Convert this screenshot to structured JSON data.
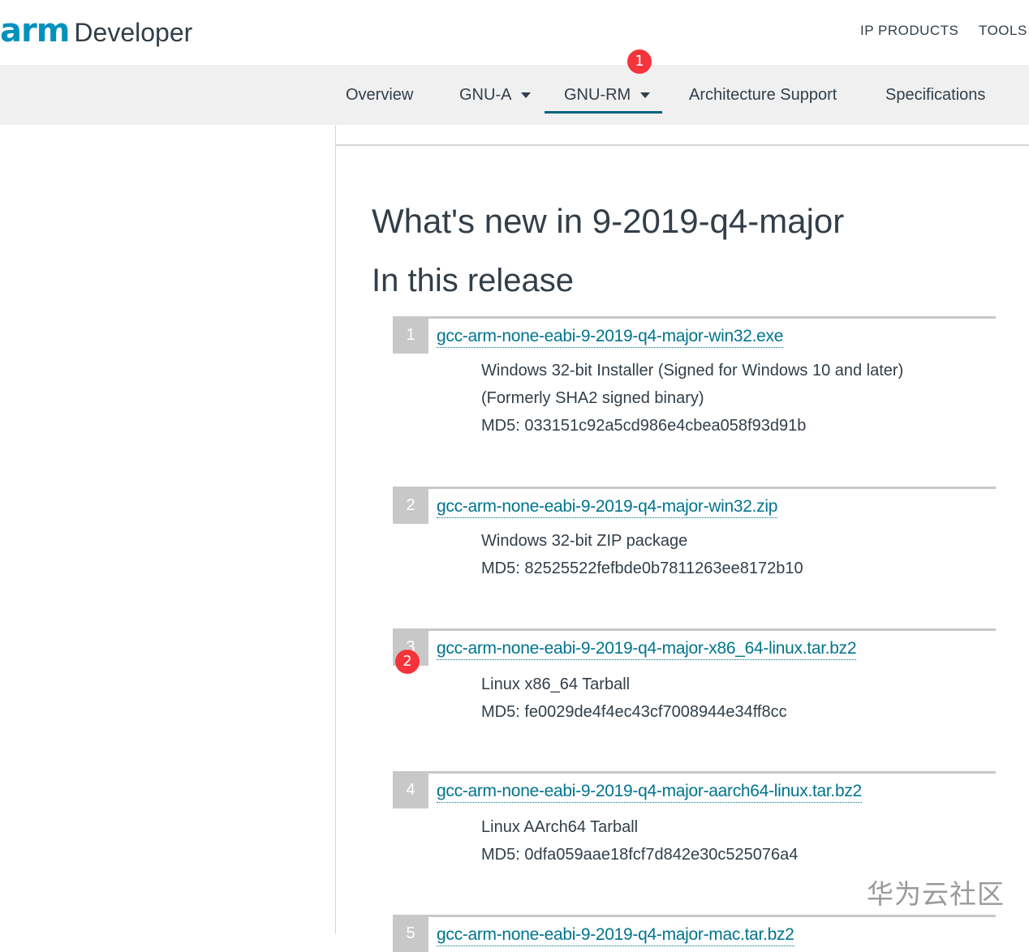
{
  "header": {
    "logo_arm": "arm",
    "logo_developer": "Developer",
    "links": [
      {
        "label": "IP PRODUCTS"
      },
      {
        "label": "TOOLS A"
      }
    ]
  },
  "subnav": {
    "items": [
      {
        "label": "Overview",
        "has_dropdown": false,
        "active": false
      },
      {
        "label": "GNU-A",
        "has_dropdown": true,
        "active": false
      },
      {
        "label": "GNU-RM",
        "has_dropdown": true,
        "active": true
      },
      {
        "label": "Architecture Support",
        "has_dropdown": false,
        "active": false
      },
      {
        "label": "Specifications",
        "has_dropdown": false,
        "active": false
      }
    ]
  },
  "annotations": [
    {
      "label": "1"
    },
    {
      "label": "2"
    }
  ],
  "main": {
    "title": "What's new in 9-2019-q4-major",
    "section_title": "In this release",
    "releases": [
      {
        "number": "1",
        "file": "gcc-arm-none-eabi-9-2019-q4-major-win32.exe",
        "description_lines": [
          "Windows 32-bit Installer (Signed for Windows 10 and later)",
          "(Formerly SHA2 signed binary)",
          "MD5: 033151c92a5cd986e4cbea058f93d91b"
        ]
      },
      {
        "number": "2",
        "file": "gcc-arm-none-eabi-9-2019-q4-major-win32.zip",
        "description_lines": [
          "Windows 32-bit ZIP package",
          "MD5: 82525522fefbde0b7811263ee8172b10"
        ]
      },
      {
        "number": "3",
        "file": "gcc-arm-none-eabi-9-2019-q4-major-x86_64-linux.tar.bz2",
        "description_lines": [
          "Linux x86_64 Tarball",
          "MD5: fe0029de4f4ec43cf7008944e34ff8cc"
        ]
      },
      {
        "number": "4",
        "file": "gcc-arm-none-eabi-9-2019-q4-major-aarch64-linux.tar.bz2",
        "description_lines": [
          "Linux AArch64 Tarball",
          "MD5: 0dfa059aae18fcf7d842e30c525076a4"
        ]
      },
      {
        "number": "5",
        "file": "gcc-arm-none-eabi-9-2019-q4-major-mac.tar.bz2",
        "description_lines": []
      }
    ]
  },
  "watermark": "华为云社区",
  "colors": {
    "link": "#00748e",
    "brand": "#0091bd",
    "marker": "#f5333a",
    "nav_background": "#f0f0f0"
  }
}
